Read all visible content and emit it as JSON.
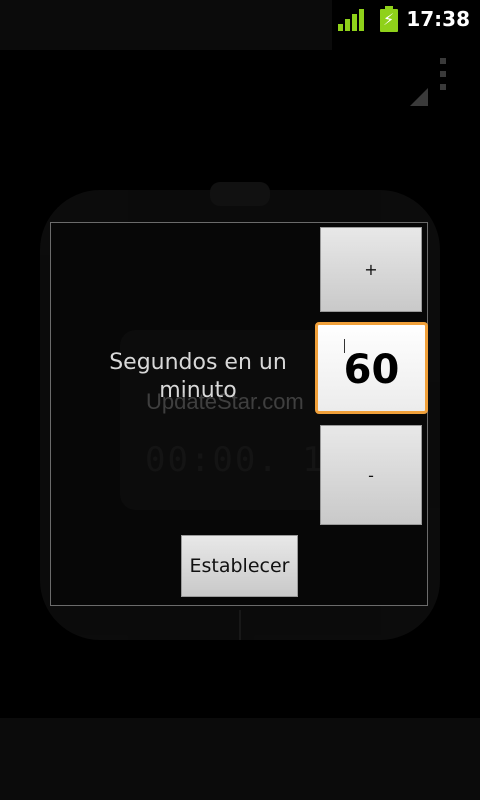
{
  "status_bar": {
    "time": "17:38",
    "signal_icon": "signal-bars-icon",
    "battery_icon": "battery-charging-icon",
    "accent_color": "#8fd11a"
  },
  "background": {
    "digits": "00:00. 10.0"
  },
  "dialog": {
    "label": "Segundos en un minuto",
    "increment_label": "+",
    "value": "60",
    "decrement_label": "-",
    "set_label": "Establecer",
    "focus_color": "#f0a03a"
  },
  "watermark": "UpdateStar.com"
}
